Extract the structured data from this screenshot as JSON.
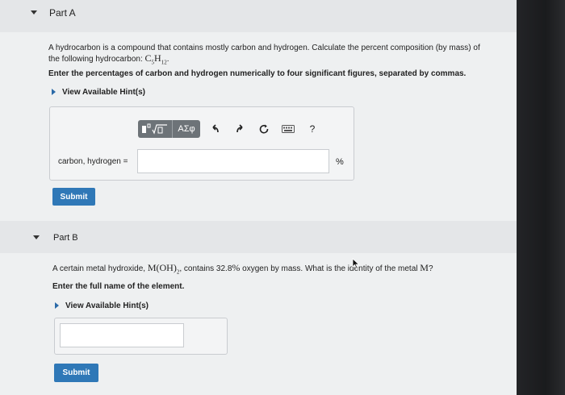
{
  "partA": {
    "title": "Part A",
    "prompt_line1": "A hydrocarbon is a compound that contains mostly carbon and hydrogen. Calculate the percent composition (by mass) of",
    "prompt_line2": "the following hydrocarbon:",
    "formula_c": "C",
    "formula_c_sub": "5",
    "formula_h": "H",
    "formula_h_sub": "12",
    "formula_end": ".",
    "instruction": "Enter the percentages of carbon and hydrogen numerically to four significant figures, separated by commas.",
    "hint_label": "View Available Hint(s)",
    "toolbar": {
      "templates_icon": "templates-icon",
      "symbols_label": "ΑΣφ",
      "undo_icon": "undo-icon",
      "redo_icon": "redo-icon",
      "reset_icon": "reset-icon",
      "keyboard_icon": "keyboard-icon",
      "help_label": "?"
    },
    "field_label": "carbon, hydrogen =",
    "field_value": "",
    "unit": "%",
    "submit_label": "Submit"
  },
  "partB": {
    "title": "Part B",
    "prompt_pre": "A certain metal hydroxide,",
    "formula_m": "M(OH)",
    "formula_sub": "2",
    "prompt_mid": ", contains 32.8",
    "percent": "%",
    "prompt_post": "oxygen by mass. What is the identity of the metal",
    "metal": "M",
    "prompt_end": "?",
    "instruction": "Enter the full name of the element.",
    "hint_label": "View Available Hint(s)",
    "field_value": "",
    "submit_label": "Submit"
  },
  "colors": {
    "accent": "#2f78b7",
    "hint_arrow": "#2a6aa8",
    "toolbar": "#6d7378"
  }
}
